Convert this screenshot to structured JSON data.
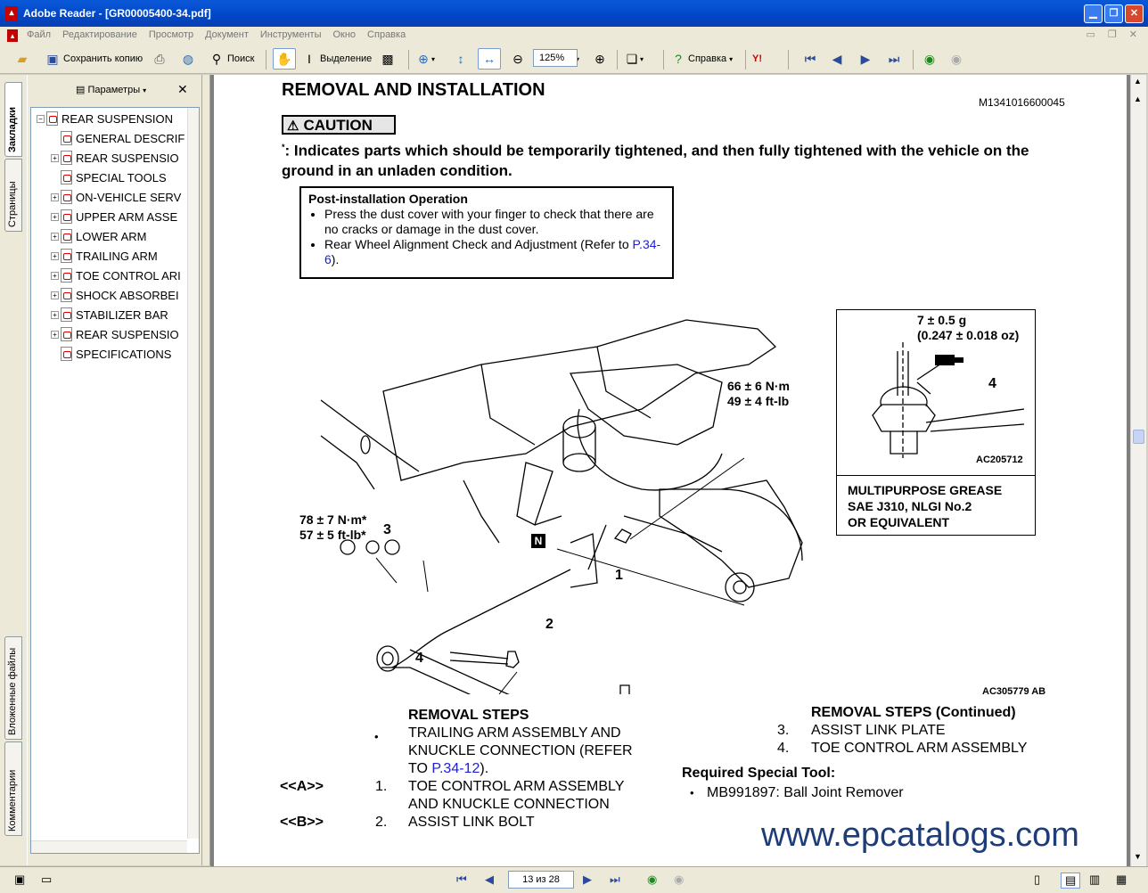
{
  "window": {
    "title": "Adobe Reader - [GR00005400-34.pdf]"
  },
  "menu": {
    "items": [
      "Файл",
      "Редактирование",
      "Просмотр",
      "Документ",
      "Инструменты",
      "Окно",
      "Справка"
    ]
  },
  "toolbar": {
    "save_copy": "Сохранить копию",
    "search": "Поиск",
    "select": "Выделение",
    "zoom_value": "125%",
    "help": "Справка"
  },
  "side_tabs": {
    "bookmarks": "Закладки",
    "pages": "Страницы",
    "attachments": "Вложенные файлы",
    "comments": "Комментарии"
  },
  "panel": {
    "options_label": "Параметры"
  },
  "bookmarks": [
    {
      "label": "REAR SUSPENSION",
      "expander": "minus"
    },
    {
      "label": "GENERAL DESCRIF",
      "expander": ""
    },
    {
      "label": "REAR SUSPENSIO",
      "expander": "plus"
    },
    {
      "label": "SPECIAL TOOLS",
      "expander": ""
    },
    {
      "label": "ON-VEHICLE SERV",
      "expander": "plus"
    },
    {
      "label": "UPPER ARM ASSE",
      "expander": "plus"
    },
    {
      "label": "LOWER ARM",
      "expander": "plus"
    },
    {
      "label": "TRAILING ARM",
      "expander": "plus"
    },
    {
      "label": "TOE CONTROL ARI",
      "expander": "plus"
    },
    {
      "label": "SHOCK ABSORBEI",
      "expander": "plus"
    },
    {
      "label": "STABILIZER BAR",
      "expander": "plus"
    },
    {
      "label": "REAR SUSPENSIO",
      "expander": "plus"
    },
    {
      "label": "SPECIFICATIONS",
      "expander": ""
    }
  ],
  "status": {
    "page_indicator": "13 из 28"
  },
  "page": {
    "title": "REMOVAL AND INSTALLATION",
    "code": "M1341016600045",
    "caution_label": "CAUTION",
    "caution_star": "*",
    "caution_text": ": Indicates parts which should be temporarily tightened, and then fully tightened with the vehicle on the ground in an unladen condition.",
    "post_heading": "Post-installation Operation",
    "post_item1": "Press the dust cover with your finger to check that there are no cracks or damage in the dust cover.",
    "post_item2_a": "Rear Wheel Alignment Check and Adjustment (Refer to ",
    "post_item2_link": "P.34-6",
    "post_item2_b": ").",
    "torque_upper_1": "66 ± 6 N·m",
    "torque_upper_2": "49 ± 4 ft-lb",
    "torque_left_1": "78 ± 7 N·m*",
    "torque_left_2": "57 ± 5 ft-lb*",
    "num_1": "1",
    "num_2": "2",
    "num_3": "3",
    "num_4": "4",
    "n_badge": "N",
    "fig_code": "AC305779 AB",
    "inset_weight_1": "7 ± 0.5 g",
    "inset_weight_2": "(0.247 ± 0.018 oz)",
    "inset_num": "4",
    "inset_code": "AC205712",
    "inset_grease_1": "MULTIPURPOSE GREASE",
    "inset_grease_2": "SAE J310, NLGI No.2",
    "inset_grease_3": "OR EQUIVALENT",
    "steps_heading": "REMOVAL STEPS",
    "bullet": "•",
    "step_bullet_text_1": "TRAILING ARM ASSEMBLY AND",
    "step_bullet_text_2": "KNUCKLE CONNECTION (REFER",
    "step_bullet_text_3a": "TO ",
    "step_bullet_link": "P.34-12",
    "step_bullet_text_3b": ").",
    "ref_a": "<<A>>",
    "step1_num": "1.",
    "step1_text_1": "TOE CONTROL ARM ASSEMBLY",
    "step1_text_2": "AND KNUCKLE CONNECTION",
    "ref_b": "<<B>>",
    "step2_num": "2.",
    "step2_text": "ASSIST LINK BOLT",
    "steps_cont_heading": "REMOVAL STEPS (Continued)",
    "step3_num": "3.",
    "step3_text": "ASSIST LINK PLATE",
    "step4_num": "4.",
    "step4_text": "TOE CONTROL ARM ASSEMBLY",
    "special_tool_heading": "Required Special Tool:",
    "special_tool_item": "MB991897: Ball Joint Remover",
    "watermark": "www.epcatalogs.com"
  }
}
